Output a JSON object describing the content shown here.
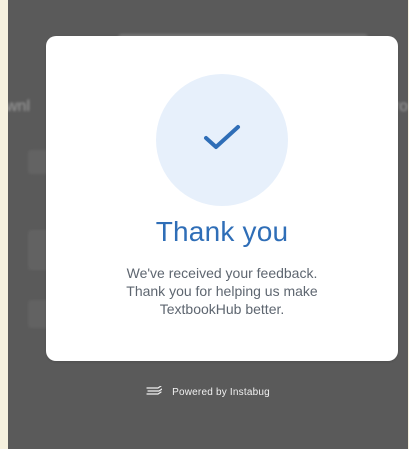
{
  "background": {
    "left_text": "wnl",
    "right_text": "rro"
  },
  "dialog": {
    "title": "Thank you",
    "message_lines": [
      "We've received your feedback.",
      "Thank you for helping us make",
      "TextbookHub better."
    ],
    "accent_color": "#2f6eb7"
  },
  "footer": {
    "text": "Powered by Instabug",
    "logo": "instabug-logo-icon"
  },
  "icons": {
    "success": "check-icon"
  }
}
